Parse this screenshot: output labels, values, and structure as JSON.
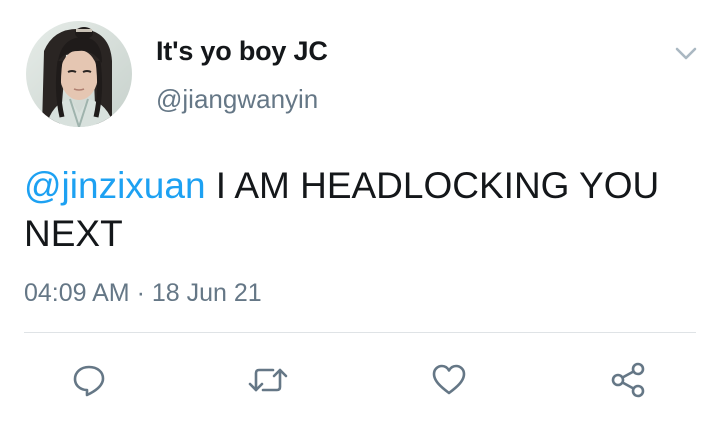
{
  "user": {
    "display_name": "It's yo boy JC",
    "handle": "@jiangwanyin"
  },
  "tweet": {
    "mention": "@jinzixuan",
    "body": " I AM HEADLOCKING YOU NEXT",
    "timestamp": "04:09 AM · 18 Jun 21"
  },
  "icons": {
    "caret": "chevron-down-icon",
    "reply": "reply-icon",
    "retweet": "retweet-icon",
    "like": "heart-icon",
    "share": "share-icon"
  },
  "colors": {
    "text": "#14171a",
    "secondary": "#657786",
    "link": "#1da1f2",
    "icon": "#657786",
    "divider": "#dfe3e6"
  }
}
